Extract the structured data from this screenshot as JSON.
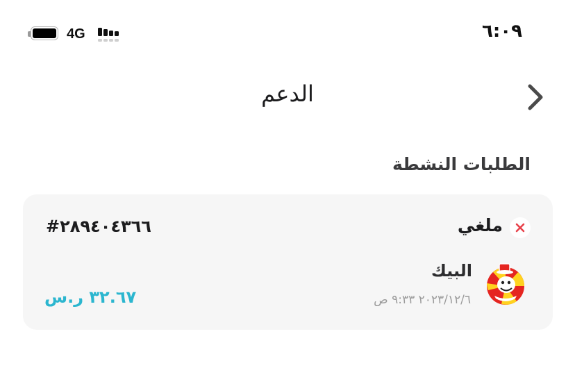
{
  "status_bar": {
    "time": "٦:٠٩",
    "network": "4G",
    "battery_icon": "battery-full-icon",
    "signal_icon": "cellular-signal-icon"
  },
  "header": {
    "title": "الدعم",
    "back_icon": "chevron-right-icon"
  },
  "section": {
    "title": "الطلبات النشطة"
  },
  "order": {
    "status": "ملغي",
    "status_icon": "cancel-x-icon",
    "status_color": "#e8414a",
    "number": "#٢٨٩٤٠٤٣٦٦",
    "restaurant": "البيك",
    "restaurant_logo_icon": "albaik-logo-icon",
    "datetime": "٢٠٢٣/١٢/٦ ٩:٣٣ ص",
    "price": "٣٢.٦٧ ر.س",
    "price_color": "#2bb6cf"
  }
}
